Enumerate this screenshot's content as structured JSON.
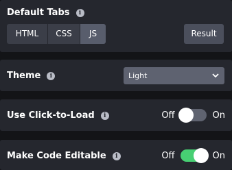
{
  "default_tabs": {
    "label": "Default Tabs",
    "tabs": [
      "HTML",
      "CSS",
      "JS"
    ],
    "selected": "JS",
    "result_label": "Result"
  },
  "theme": {
    "label": "Theme",
    "selected_value": "Light"
  },
  "click_to_load": {
    "label": "Use Click-to-Load",
    "off_label": "Off",
    "on_label": "On",
    "state": "off"
  },
  "code_editable": {
    "label": "Make Code Editable",
    "off_label": "Off",
    "on_label": "On",
    "state": "on"
  },
  "colors": {
    "background": "#131417",
    "panel": "#25272e",
    "toggle_on": "#47cf73"
  },
  "icons": {
    "info": "info-icon",
    "chevron": "chevron-down-icon"
  }
}
